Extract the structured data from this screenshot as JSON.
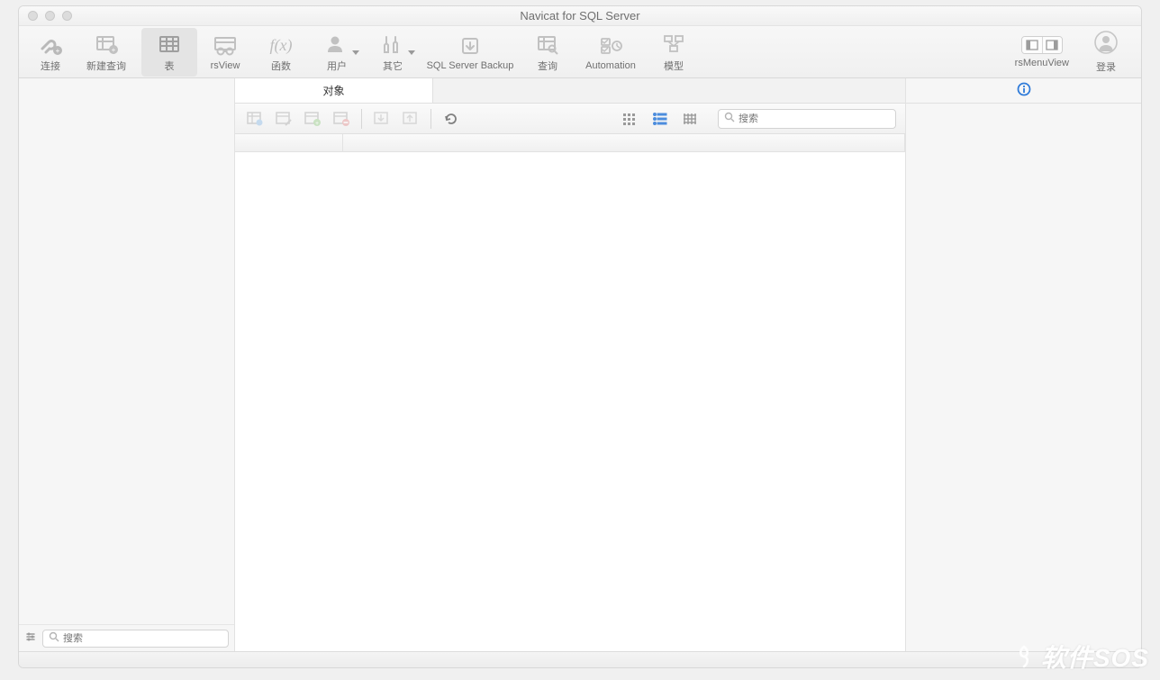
{
  "titlebar": {
    "title": "Navicat for SQL Server"
  },
  "toolbar": {
    "connection": "连接",
    "new_query": "新建查询",
    "table": "表",
    "rsview": "rsView",
    "function": "函数",
    "user": "用户",
    "other": "其它",
    "backup": "SQL Server Backup",
    "query": "查询",
    "automation": "Automation",
    "model": "模型",
    "rs_menu_view": "rsMenuView",
    "login": "登录"
  },
  "tabs": {
    "objects": "对象"
  },
  "search": {
    "placeholder": "搜索"
  },
  "sidebar_search": {
    "placeholder": "搜索"
  },
  "watermark": "软件SOS"
}
